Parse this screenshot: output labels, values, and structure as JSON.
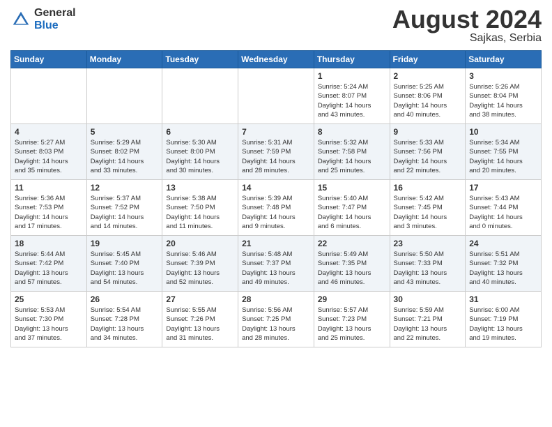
{
  "header": {
    "logo_general": "General",
    "logo_blue": "Blue",
    "month_title": "August 2024",
    "location": "Sajkas, Serbia"
  },
  "weekdays": [
    "Sunday",
    "Monday",
    "Tuesday",
    "Wednesday",
    "Thursday",
    "Friday",
    "Saturday"
  ],
  "weeks": [
    [
      {
        "day": "",
        "info": ""
      },
      {
        "day": "",
        "info": ""
      },
      {
        "day": "",
        "info": ""
      },
      {
        "day": "",
        "info": ""
      },
      {
        "day": "1",
        "info": "Sunrise: 5:24 AM\nSunset: 8:07 PM\nDaylight: 14 hours\nand 43 minutes."
      },
      {
        "day": "2",
        "info": "Sunrise: 5:25 AM\nSunset: 8:06 PM\nDaylight: 14 hours\nand 40 minutes."
      },
      {
        "day": "3",
        "info": "Sunrise: 5:26 AM\nSunset: 8:04 PM\nDaylight: 14 hours\nand 38 minutes."
      }
    ],
    [
      {
        "day": "4",
        "info": "Sunrise: 5:27 AM\nSunset: 8:03 PM\nDaylight: 14 hours\nand 35 minutes."
      },
      {
        "day": "5",
        "info": "Sunrise: 5:29 AM\nSunset: 8:02 PM\nDaylight: 14 hours\nand 33 minutes."
      },
      {
        "day": "6",
        "info": "Sunrise: 5:30 AM\nSunset: 8:00 PM\nDaylight: 14 hours\nand 30 minutes."
      },
      {
        "day": "7",
        "info": "Sunrise: 5:31 AM\nSunset: 7:59 PM\nDaylight: 14 hours\nand 28 minutes."
      },
      {
        "day": "8",
        "info": "Sunrise: 5:32 AM\nSunset: 7:58 PM\nDaylight: 14 hours\nand 25 minutes."
      },
      {
        "day": "9",
        "info": "Sunrise: 5:33 AM\nSunset: 7:56 PM\nDaylight: 14 hours\nand 22 minutes."
      },
      {
        "day": "10",
        "info": "Sunrise: 5:34 AM\nSunset: 7:55 PM\nDaylight: 14 hours\nand 20 minutes."
      }
    ],
    [
      {
        "day": "11",
        "info": "Sunrise: 5:36 AM\nSunset: 7:53 PM\nDaylight: 14 hours\nand 17 minutes."
      },
      {
        "day": "12",
        "info": "Sunrise: 5:37 AM\nSunset: 7:52 PM\nDaylight: 14 hours\nand 14 minutes."
      },
      {
        "day": "13",
        "info": "Sunrise: 5:38 AM\nSunset: 7:50 PM\nDaylight: 14 hours\nand 11 minutes."
      },
      {
        "day": "14",
        "info": "Sunrise: 5:39 AM\nSunset: 7:48 PM\nDaylight: 14 hours\nand 9 minutes."
      },
      {
        "day": "15",
        "info": "Sunrise: 5:40 AM\nSunset: 7:47 PM\nDaylight: 14 hours\nand 6 minutes."
      },
      {
        "day": "16",
        "info": "Sunrise: 5:42 AM\nSunset: 7:45 PM\nDaylight: 14 hours\nand 3 minutes."
      },
      {
        "day": "17",
        "info": "Sunrise: 5:43 AM\nSunset: 7:44 PM\nDaylight: 14 hours\nand 0 minutes."
      }
    ],
    [
      {
        "day": "18",
        "info": "Sunrise: 5:44 AM\nSunset: 7:42 PM\nDaylight: 13 hours\nand 57 minutes."
      },
      {
        "day": "19",
        "info": "Sunrise: 5:45 AM\nSunset: 7:40 PM\nDaylight: 13 hours\nand 54 minutes."
      },
      {
        "day": "20",
        "info": "Sunrise: 5:46 AM\nSunset: 7:39 PM\nDaylight: 13 hours\nand 52 minutes."
      },
      {
        "day": "21",
        "info": "Sunrise: 5:48 AM\nSunset: 7:37 PM\nDaylight: 13 hours\nand 49 minutes."
      },
      {
        "day": "22",
        "info": "Sunrise: 5:49 AM\nSunset: 7:35 PM\nDaylight: 13 hours\nand 46 minutes."
      },
      {
        "day": "23",
        "info": "Sunrise: 5:50 AM\nSunset: 7:33 PM\nDaylight: 13 hours\nand 43 minutes."
      },
      {
        "day": "24",
        "info": "Sunrise: 5:51 AM\nSunset: 7:32 PM\nDaylight: 13 hours\nand 40 minutes."
      }
    ],
    [
      {
        "day": "25",
        "info": "Sunrise: 5:53 AM\nSunset: 7:30 PM\nDaylight: 13 hours\nand 37 minutes."
      },
      {
        "day": "26",
        "info": "Sunrise: 5:54 AM\nSunset: 7:28 PM\nDaylight: 13 hours\nand 34 minutes."
      },
      {
        "day": "27",
        "info": "Sunrise: 5:55 AM\nSunset: 7:26 PM\nDaylight: 13 hours\nand 31 minutes."
      },
      {
        "day": "28",
        "info": "Sunrise: 5:56 AM\nSunset: 7:25 PM\nDaylight: 13 hours\nand 28 minutes."
      },
      {
        "day": "29",
        "info": "Sunrise: 5:57 AM\nSunset: 7:23 PM\nDaylight: 13 hours\nand 25 minutes."
      },
      {
        "day": "30",
        "info": "Sunrise: 5:59 AM\nSunset: 7:21 PM\nDaylight: 13 hours\nand 22 minutes."
      },
      {
        "day": "31",
        "info": "Sunrise: 6:00 AM\nSunset: 7:19 PM\nDaylight: 13 hours\nand 19 minutes."
      }
    ]
  ]
}
